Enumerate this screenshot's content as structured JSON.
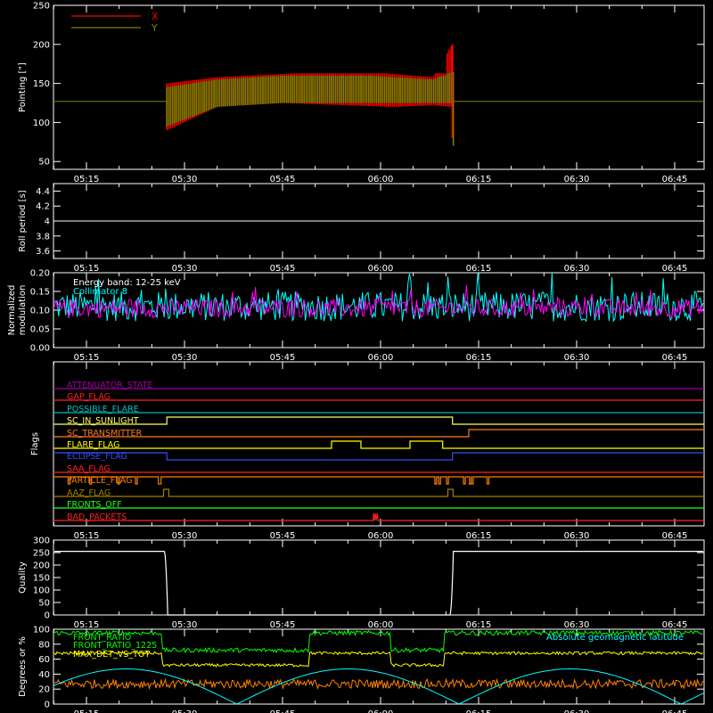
{
  "timeline": {
    "tick_labels": [
      "05:15",
      "05:30",
      "05:45",
      "06:00",
      "06:15",
      "06:30",
      "06:45"
    ]
  },
  "chart_data": [
    {
      "type": "line",
      "ylabel": "Pointing [\"]",
      "ylim": [
        40,
        250
      ],
      "yticks": [
        50,
        100,
        150,
        200,
        250
      ],
      "legend": "top-left",
      "series": [
        {
          "name": "X",
          "color": "#ff0000",
          "envelope_min": [
            90,
            120,
            125,
            122,
            120,
            122,
            120
          ],
          "envelope_max": [
            150,
            158,
            162,
            168,
            162,
            158,
            200
          ]
        },
        {
          "name": "Y",
          "color": "#808000",
          "envelope_min": [
            95,
            120,
            125,
            125,
            125,
            125,
            125
          ],
          "envelope_max": [
            145,
            155,
            160,
            162,
            158,
            155,
            165
          ]
        }
      ],
      "reference_level": 127,
      "reference_color": "#808000"
    },
    {
      "type": "line",
      "ylabel": "Roll period [s]",
      "ylim": [
        3.5,
        4.5
      ],
      "yticks": [
        3.6,
        3.8,
        4.0,
        4.2,
        4.4
      ],
      "series": [
        {
          "name": "",
          "color": "#ffffff",
          "constant": 4.0
        }
      ]
    },
    {
      "type": "line",
      "ylabel": "Normalized modulation",
      "ylim": [
        0,
        0.2
      ],
      "yticks": [
        "0.00",
        "0.05",
        "0.10",
        "0.15",
        "0.20"
      ],
      "annotations": [
        {
          "text": "Energy band: 12-25 keV",
          "color": "#ffffff"
        },
        {
          "text": "Collimator 8",
          "color": "#00ffff"
        }
      ],
      "series": [
        {
          "name": "",
          "color": "#00ffff",
          "mean": 0.11,
          "spread": 0.04
        },
        {
          "name": "",
          "color": "#ff00ff",
          "mean": 0.105,
          "spread": 0.025
        }
      ]
    },
    {
      "type": "line",
      "ylabel": "Flags",
      "flags": [
        {
          "label": "ATTENUATOR_STATE",
          "color": "#a000a0"
        },
        {
          "label": "GAP_FLAG",
          "color": "#ff2020"
        },
        {
          "label": "POSSIBLE_FLARE",
          "color": "#00c0c0"
        },
        {
          "label": "SC_IN_SUNLIGHT",
          "color": "#ffff60"
        },
        {
          "label": "SC_TRANSMITTER",
          "color": "#ff7a20"
        },
        {
          "label": "FLARE_FLAG",
          "color": "#ffff00"
        },
        {
          "label": "ECLIPSE_FLAG",
          "color": "#3050ff"
        },
        {
          "label": "SAA_FLAG",
          "color": "#ff2020"
        },
        {
          "label": "PARTICLE_FLAG",
          "color": "#ff8000"
        },
        {
          "label": "AAZ_FLAG",
          "color": "#a08000"
        },
        {
          "label": "FRONTS_OFF",
          "color": "#20ff20"
        },
        {
          "label": "BAD_PACKETS",
          "color": "#ff2020"
        }
      ]
    },
    {
      "type": "line",
      "ylabel": "Quality",
      "ylim": [
        0,
        300
      ],
      "yticks": [
        0,
        50,
        100,
        150,
        200,
        250,
        300
      ],
      "series": [
        {
          "name": "",
          "color": "#ffffff",
          "high": 255,
          "low": 0
        }
      ]
    },
    {
      "type": "line",
      "ylabel": "Degrees or %",
      "ylim": [
        0,
        100
      ],
      "yticks": [
        0,
        20,
        40,
        60,
        80,
        100
      ],
      "legend": "top-left",
      "series": [
        {
          "name": "FRONT_RATIO",
          "color": "#ffff00",
          "high": 68,
          "low": 52
        },
        {
          "name": "FRONT_RATIO_1225",
          "color": "#00ff00",
          "high": 95,
          "low": 72
        },
        {
          "name": "MAX_DET_VS_TOT",
          "color": "#ff8000",
          "mean": 27,
          "spread": 6
        },
        {
          "name": "Absolute geomagnetic latitude",
          "color": "#00ffff"
        }
      ]
    }
  ]
}
